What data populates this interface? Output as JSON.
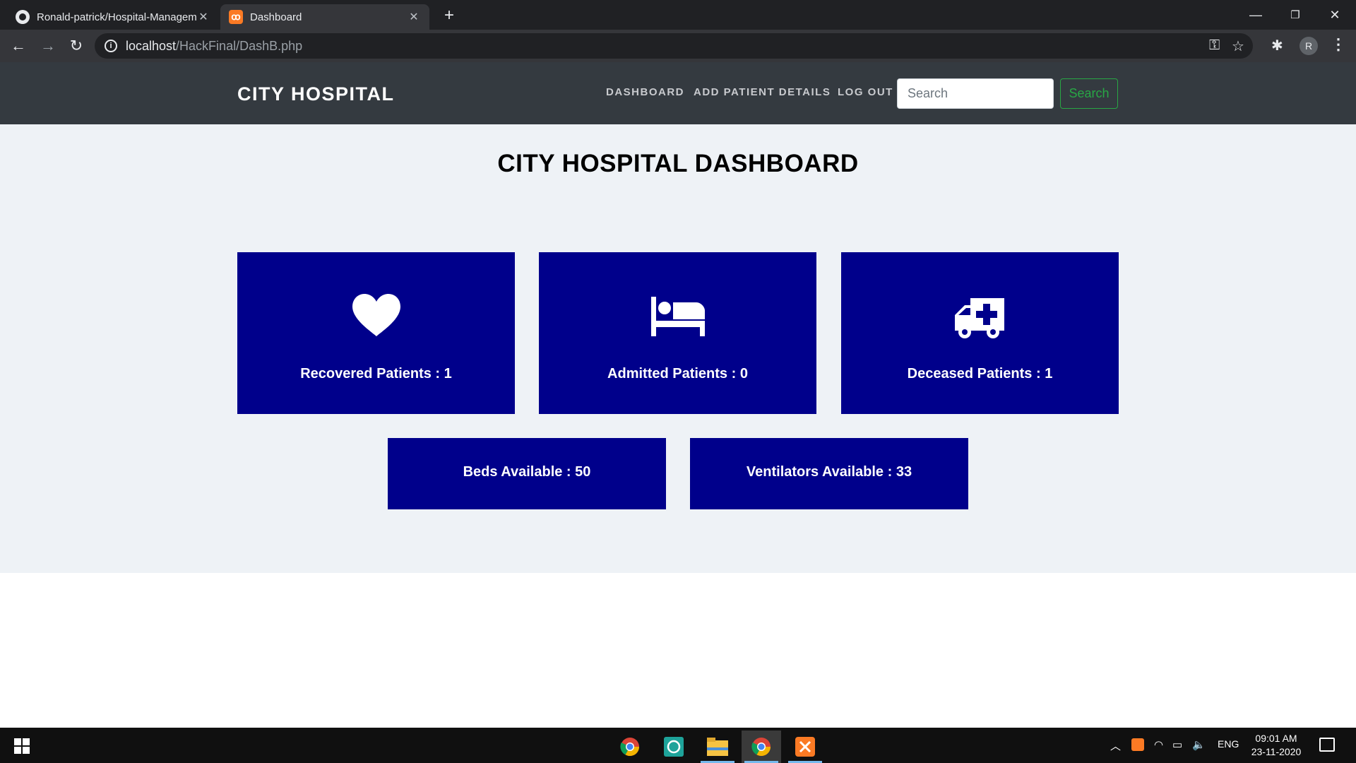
{
  "browser": {
    "tabs": [
      {
        "title": "Ronald-patrick/Hospital-Management",
        "favicon": "github-icon"
      },
      {
        "title": "Dashboard",
        "favicon": "xampp-icon"
      }
    ],
    "url_host": "localhost",
    "url_path": "/HackFinal/DashB.php",
    "profile_initial": "R"
  },
  "nav": {
    "brand": "CITY HOSPITAL",
    "links": [
      "DASHBOARD",
      "ADD PATIENT DETAILS",
      "LOG OUT"
    ],
    "search_placeholder": "Search",
    "search_button": "Search"
  },
  "dashboard": {
    "title": "CITY HOSPITAL DASHBOARD",
    "stats": [
      {
        "label": "Recovered Patients : 1",
        "icon": "heart-icon"
      },
      {
        "label": "Admitted Patients : 0",
        "icon": "bed-icon"
      },
      {
        "label": "Deceased Patients : 1",
        "icon": "ambulance-icon"
      }
    ],
    "resources": [
      {
        "label": "Beds Available : 50"
      },
      {
        "label": "Ventilators Available : 33"
      }
    ],
    "card_color": "#00008b"
  },
  "taskbar": {
    "language": "ENG",
    "time": "09:01 AM",
    "date": "23-11-2020"
  }
}
